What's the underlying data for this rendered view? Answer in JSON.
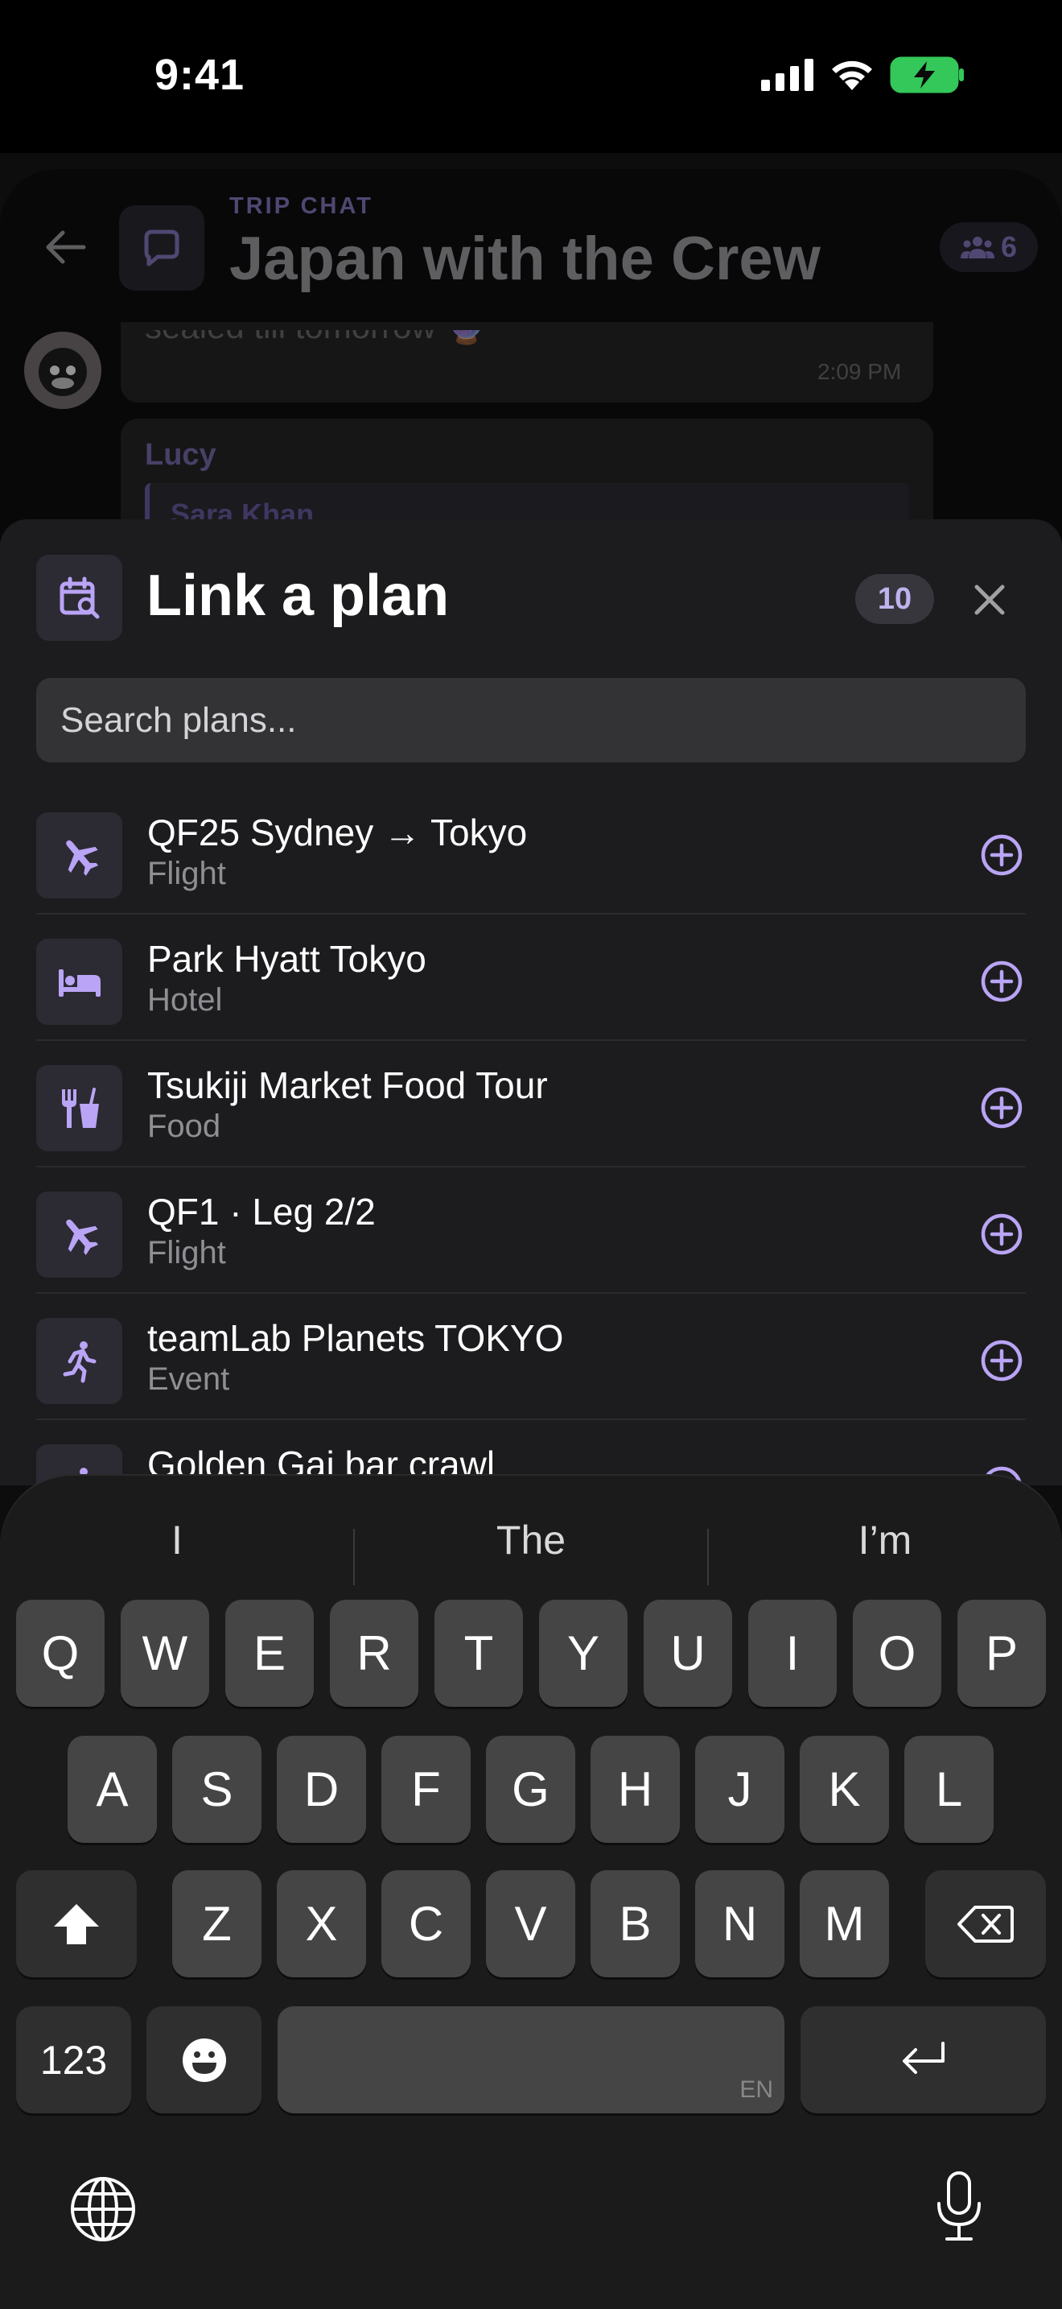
{
  "status_bar": {
    "time": "9:41"
  },
  "chat": {
    "eyebrow": "TRIP CHAT",
    "title": "Japan with the Crew",
    "member_count": "6",
    "message1_partial": "sealed till tomorrow 🔮",
    "message1_time": "2:09 PM",
    "message2_author": "Lucy",
    "message2_quote_author": "Sara Khan"
  },
  "sheet": {
    "title": "Link a plan",
    "count": "10",
    "search_placeholder": "Search plans...",
    "plans": [
      {
        "title": "QF25 Sydney → Tokyo",
        "type": "Flight",
        "icon": "plane-icon"
      },
      {
        "title": "Park Hyatt Tokyo",
        "type": "Hotel",
        "icon": "bed-icon"
      },
      {
        "title": "Tsukiji Market Food Tour",
        "type": "Food",
        "icon": "food-icon"
      },
      {
        "title": "QF1 · Leg 2/2",
        "type": "Flight",
        "icon": "plane-icon"
      },
      {
        "title": "teamLab Planets TOKYO",
        "type": "Event",
        "icon": "runner-icon"
      },
      {
        "title": "Golden Gai bar crawl",
        "type": "",
        "icon": "runner-icon"
      }
    ]
  },
  "keyboard": {
    "suggestions": [
      "I",
      "The",
      "I’m"
    ],
    "row1": [
      "Q",
      "W",
      "E",
      "R",
      "T",
      "Y",
      "U",
      "I",
      "O",
      "P"
    ],
    "row2": [
      "A",
      "S",
      "D",
      "F",
      "G",
      "H",
      "J",
      "K",
      "L"
    ],
    "row3": [
      "Z",
      "X",
      "C",
      "V",
      "B",
      "N",
      "M"
    ],
    "numbers_label": "123",
    "space_lang": "EN"
  },
  "colors": {
    "accent": "#b9a4f5",
    "sheet_bg": "#1c1c1e",
    "key_bg": "#454545"
  }
}
